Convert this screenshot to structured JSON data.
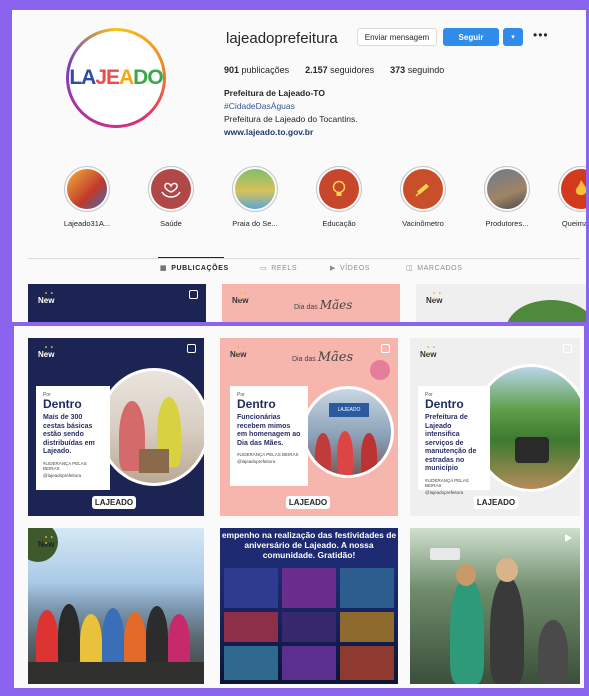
{
  "profile": {
    "username": "lajeadoprefeitura",
    "logo_text": [
      "LA",
      "JE",
      "A",
      "DO"
    ],
    "buttons": {
      "message": "Enviar mensagem",
      "follow": "Seguir",
      "dropdown": "▾",
      "more": "•••"
    },
    "stats": {
      "posts_count": "901",
      "posts_label": "publicações",
      "followers_count": "2.157",
      "followers_label": "seguidores",
      "following_count": "373",
      "following_label": "seguindo"
    },
    "bio": {
      "name": "Prefeitura de Lajeado-TO",
      "hashtag": "#CidadeDasÁguas",
      "description": "Prefeitura de Lajeado do Tocantins.",
      "link": "www.lajeado.to.gov.br"
    }
  },
  "highlights": [
    {
      "label": "Lajeado31A...",
      "color": "#c0392b",
      "icon": "festival-photo-icon"
    },
    {
      "label": "Saúde",
      "color": "#b04848",
      "icon": "health-hands-icon"
    },
    {
      "label": "Praia do Se...",
      "color": "#d8c15a",
      "icon": "beach-icon"
    },
    {
      "label": "Educação",
      "color": "#c8462c",
      "icon": "lightbulb-icon"
    },
    {
      "label": "Vacinômetro",
      "color": "#c94f2a",
      "icon": "syringe-icon"
    },
    {
      "label": "Produtores...",
      "color": "#7a6a5a",
      "icon": "producers-photo-icon"
    },
    {
      "label": "Queimadas",
      "color": "#d33a1d",
      "icon": "fire-icon"
    }
  ],
  "tabs": [
    {
      "label": "PUBLICAÇÕES",
      "icon": "▦",
      "active": true
    },
    {
      "label": "REELS",
      "icon": "▭",
      "active": false
    },
    {
      "label": "VÍDEOS",
      "icon": "▶",
      "active": false
    },
    {
      "label": "MARCADOS",
      "icon": "◫",
      "active": false
    }
  ],
  "posts": {
    "new_label": "New",
    "dots": "• • •",
    "header_text": "Dia das",
    "header_script": "Mães",
    "por": "Por",
    "dentro": "Dentro",
    "insta_text": "@lajeadoprefeitura",
    "tagline": "#LIDERANÇA PELAS BEIRAS",
    "mini_logo": "LAJEADO",
    "sign_text": "LAJEADO",
    "post1_text": "Mais de 300 cestas básicas estão sendo distribuídas em Lajeado.",
    "post2_text": "Funcionárias recebem mimos em homenagem ao Dia das Mães.",
    "post3_text": "Prefeitura de Lajeado intensifica serviços de manutenção de estradas no município",
    "post5_caption": "empenho na realização das festividades de aniversário de Lajeado. A nossa comunidade. Gratidão!"
  }
}
